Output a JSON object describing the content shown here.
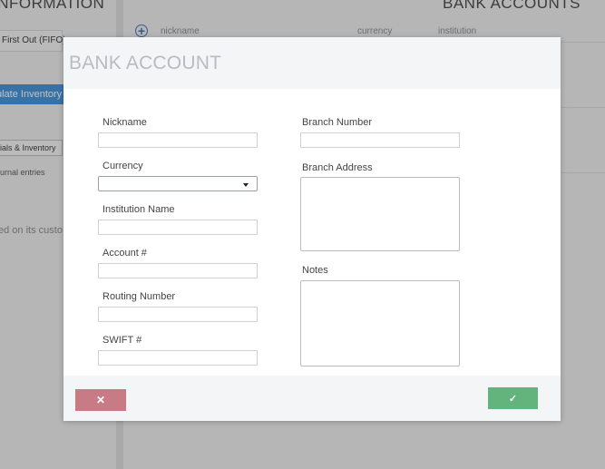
{
  "background": {
    "left_heading": "INFORMATION",
    "right_heading": "BANK ACCOUNTS",
    "fifo_label": "First Out (FIFO)",
    "recalc_button": "ulate Inventory",
    "materials_button": "ials & Inventory",
    "journal_text": "urnal entries",
    "customer_text": "ed on its custo",
    "table_columns": [
      "nickname",
      "currency",
      "institution"
    ]
  },
  "modal": {
    "title": "BANK ACCOUNT",
    "left_fields": [
      {
        "label": "Nickname",
        "value": ""
      },
      {
        "label": "Currency",
        "value": ""
      },
      {
        "label": "Institution Name",
        "value": ""
      },
      {
        "label": "Account #",
        "value": ""
      },
      {
        "label": "Routing Number",
        "value": ""
      },
      {
        "label": "SWIFT #",
        "value": ""
      }
    ],
    "right_fields": [
      {
        "label": "Branch Number",
        "value": ""
      },
      {
        "label": "Branch Address",
        "value": ""
      },
      {
        "label": "Notes",
        "value": ""
      }
    ],
    "cancel_glyph": "✕",
    "ok_glyph": "✓",
    "cancel_color": "#c97b85",
    "ok_color": "#62b37c"
  }
}
